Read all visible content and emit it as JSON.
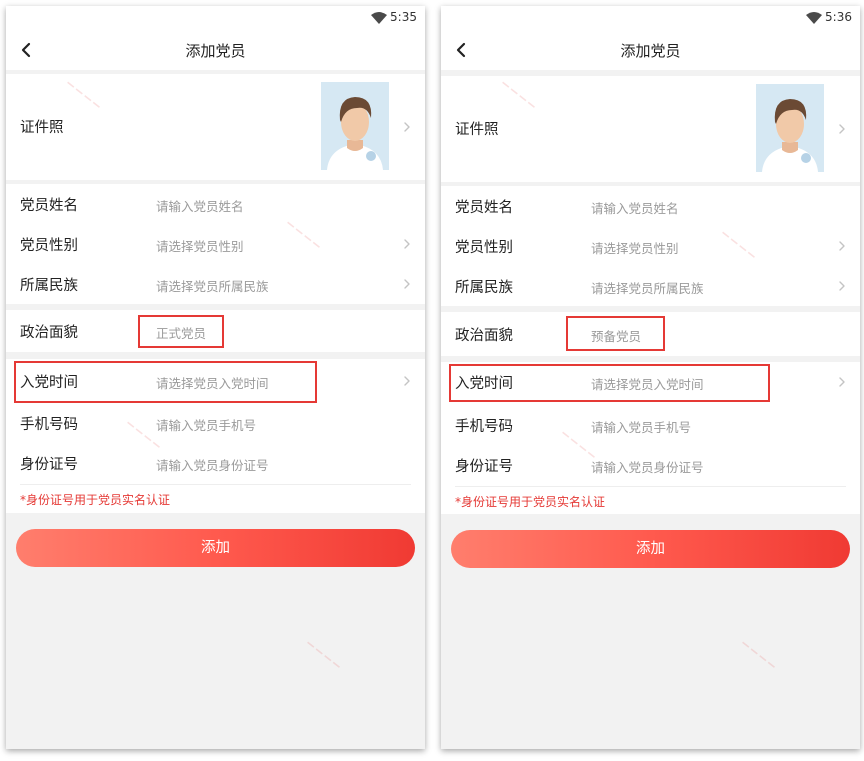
{
  "screens": [
    {
      "status_time": "5:35",
      "title": "添加党员",
      "photo_label": "证件照",
      "fields": [
        {
          "label": "党员姓名",
          "value": "请输入党员姓名"
        },
        {
          "label": "党员性别",
          "value": "请选择党员性别"
        },
        {
          "label": "所属民族",
          "value": "请选择党员所属民族"
        },
        {
          "label": "政治面貌",
          "value": "正式党员"
        },
        {
          "label": "入党时间",
          "value": "请选择党员入党时间"
        },
        {
          "label": "手机号码",
          "value": "请输入党员手机号"
        },
        {
          "label": "身份证号",
          "value": "请输入党员身份证号"
        }
      ],
      "hint": "*身份证号用于党员实名认证",
      "add_label": "添加"
    },
    {
      "status_time": "5:36",
      "title": "添加党员",
      "photo_label": "证件照",
      "fields": [
        {
          "label": "党员姓名",
          "value": "请输入党员姓名"
        },
        {
          "label": "党员性别",
          "value": "请选择党员性别"
        },
        {
          "label": "所属民族",
          "value": "请选择党员所属民族"
        },
        {
          "label": "政治面貌",
          "value": "预备党员"
        },
        {
          "label": "入党时间",
          "value": "请选择党员入党时间"
        },
        {
          "label": "手机号码",
          "value": "请输入党员手机号"
        },
        {
          "label": "身份证号",
          "value": "请输入党员身份证号"
        }
      ],
      "hint": "*身份证号用于党员实名认证",
      "add_label": "添加"
    }
  ],
  "colors": {
    "accent": "#f03a33",
    "highlight": "#e53935",
    "hint": "#e53935"
  },
  "icons": [
    "wifi-icon",
    "back-arrow-icon",
    "chevron-right-icon",
    "avatar-photo"
  ]
}
